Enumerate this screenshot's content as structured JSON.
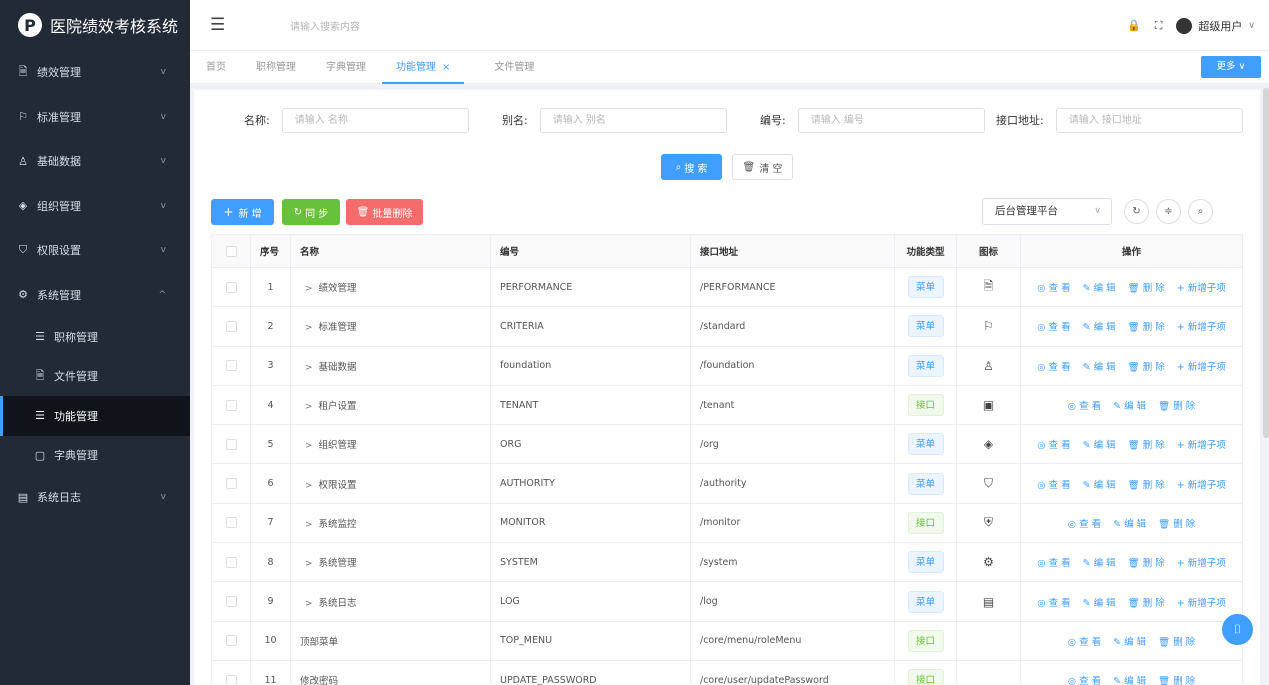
{
  "app": {
    "title": "医院绩效考核系统",
    "logo_letter": "P"
  },
  "sidebar": {
    "top_items": [
      {
        "label": "绩效管理",
        "icon": "document-icon"
      },
      {
        "label": "标准管理",
        "icon": "flag-icon"
      },
      {
        "label": "基础数据",
        "icon": "user-icon"
      },
      {
        "label": "组织管理",
        "icon": "tag-icon"
      },
      {
        "label": "权限设置",
        "icon": "shield-icon"
      },
      {
        "label": "系统管理",
        "icon": "gear-icon"
      }
    ],
    "sub_items": [
      {
        "label": "职称管理",
        "icon": "list-icon"
      },
      {
        "label": "文件管理",
        "icon": "document-icon"
      },
      {
        "label": "功能管理",
        "icon": "list-icon",
        "active": true
      },
      {
        "label": "字典管理",
        "icon": "book-icon"
      }
    ],
    "bottom_items": [
      {
        "label": "系统日志",
        "icon": "log-icon"
      }
    ]
  },
  "topbar": {
    "search_placeholder": "请输入搜索内容",
    "user_name": "超级用户"
  },
  "tabs": {
    "items": [
      "首页",
      "职称管理",
      "字典管理",
      "功能管理",
      "文件管理"
    ],
    "active_index": 3,
    "more_label": "更多"
  },
  "search_form": {
    "name_label": "名称:",
    "name_placeholder": "请输入 名称",
    "alias_label": "别名:",
    "alias_placeholder": "请输入 别名",
    "code_label": "编号:",
    "code_placeholder": "请输入 编号",
    "api_label": "接口地址:",
    "api_placeholder": "请输入 接口地址",
    "search_label": "搜 索",
    "clear_label": "清 空"
  },
  "toolbar": {
    "add_label": "新 增",
    "sync_label": "同 步",
    "batch_delete_label": "批量删除",
    "platform": "后台管理平台"
  },
  "table": {
    "headers": [
      "序号",
      "名称",
      "编号",
      "接口地址",
      "功能类型",
      "图标",
      "操作"
    ],
    "op_labels": {
      "view": "查 看",
      "edit": "编 辑",
      "delete": "删 除",
      "add_child": "新增子项"
    },
    "rows": [
      {
        "no": "1",
        "name": "绩效管理",
        "code": "PERFORMANCE",
        "api": "/PERFORMANCE",
        "type": "菜单",
        "icon": "document-icon",
        "glyph": "🗎",
        "expand": true,
        "add_child": true
      },
      {
        "no": "2",
        "name": "标准管理",
        "code": "CRITERIA",
        "api": "/standard",
        "type": "菜单",
        "icon": "flag-icon",
        "glyph": "⚐",
        "expand": true,
        "add_child": true
      },
      {
        "no": "3",
        "name": "基础数据",
        "code": "foundation",
        "api": "/foundation",
        "type": "菜单",
        "icon": "user-icon",
        "glyph": "♙",
        "expand": true,
        "add_child": true
      },
      {
        "no": "4",
        "name": "租户设置",
        "code": "TENANT",
        "api": "/tenant",
        "type": "接口",
        "icon": "tenant-icon",
        "glyph": "▣",
        "expand": true,
        "add_child": false
      },
      {
        "no": "5",
        "name": "组织管理",
        "code": "ORG",
        "api": "/org",
        "type": "菜单",
        "icon": "tag-icon",
        "glyph": "◈",
        "expand": true,
        "add_child": true
      },
      {
        "no": "6",
        "name": "权限设置",
        "code": "AUTHORITY",
        "api": "/authority",
        "type": "菜单",
        "icon": "shield-icon",
        "glyph": "⛉",
        "expand": true,
        "add_child": true
      },
      {
        "no": "7",
        "name": "系统监控",
        "code": "MONITOR",
        "api": "/monitor",
        "type": "接口",
        "icon": "monitor-shield-icon",
        "glyph": "⛨",
        "expand": true,
        "add_child": false
      },
      {
        "no": "8",
        "name": "系统管理",
        "code": "SYSTEM",
        "api": "/system",
        "type": "菜单",
        "icon": "gear-icon",
        "glyph": "⚙",
        "expand": true,
        "add_child": true
      },
      {
        "no": "9",
        "name": "系统日志",
        "code": "LOG",
        "api": "/log",
        "type": "菜单",
        "icon": "log-icon",
        "glyph": "▤",
        "expand": true,
        "add_child": true
      },
      {
        "no": "10",
        "name": "顶部菜单",
        "code": "TOP_MENU",
        "api": "/core/menu/roleMenu",
        "type": "接口",
        "icon": "",
        "glyph": "",
        "expand": false,
        "add_child": false
      },
      {
        "no": "11",
        "name": "修改密码",
        "code": "UPDATE_PASSWORD",
        "api": "/core/user/updatePassword",
        "type": "接口",
        "icon": "",
        "glyph": "",
        "expand": false,
        "add_child": false
      }
    ]
  }
}
